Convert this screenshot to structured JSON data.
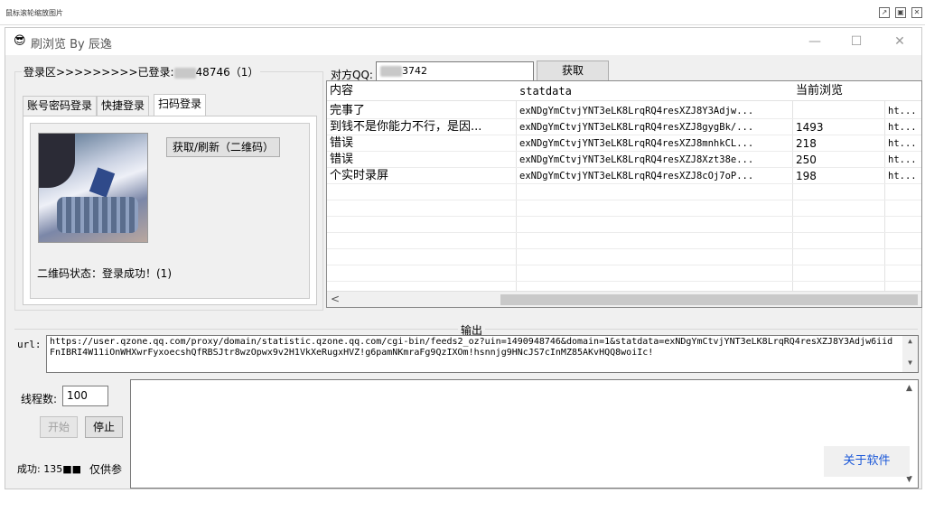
{
  "viewer": {
    "title": "鼠标滚轮缩放图片",
    "buttons": [
      "↗",
      "▣",
      "✕"
    ]
  },
  "app": {
    "title": "刷浏览 By 辰逸",
    "icon": "sunglasses-face-icon",
    "controls": {
      "minimize": "—",
      "maximize": "☐",
      "close": "✕"
    }
  },
  "login": {
    "group_title_prefix": "登录区>>>>>>>>>已登录:",
    "logged_in_suffix": "48746（1）",
    "tabs": [
      "账号密码登录",
      "快捷登录",
      "扫码登录"
    ],
    "active_tab": 2,
    "qr_button": "获取/刷新（二维码）",
    "qr_status": "二维码状态：登录成功！(1)"
  },
  "target": {
    "label": "对方QQ:",
    "value_suffix": "3742",
    "fetch_button": "获取"
  },
  "grid": {
    "columns": [
      "内容",
      "statdata",
      "当前浏览",
      ""
    ],
    "rows": [
      {
        "content": "完事了",
        "statdata": "exNDgYmCtvjYNT3eLK8LrqRQ4resXZJ8Y3Adjw...",
        "views": "",
        "link": "ht..."
      },
      {
        "content": "到钱不是你能力不行，是因...",
        "statdata": "exNDgYmCtvjYNT3eLK8LrqRQ4resXZJ8gygBk/...",
        "views": "1493",
        "link": "ht..."
      },
      {
        "content": "错误",
        "statdata": "exNDgYmCtvjYNT3eLK8LrqRQ4resXZJ8mnhkCL...",
        "views": "218",
        "link": "ht..."
      },
      {
        "content": "错误",
        "statdata": "exNDgYmCtvjYNT3eLK8LrqRQ4resXZJ8Xzt38e...",
        "views": "250",
        "link": "ht..."
      },
      {
        "content": "个实时录屏",
        "statdata": "exNDgYmCtvjYNT3eLK8LrqRQ4resXZJ8cOj7oP...",
        "views": "198",
        "link": "ht..."
      }
    ],
    "scroll_left": "<"
  },
  "output": {
    "title": "输出",
    "url_label": "url:",
    "url_value": "https://user.qzone.qq.com/proxy/domain/statistic.qzone.qq.com/cgi-bin/feeds2_oz?uin=1490948746&domain=1&statdata=exNDgYmCtvjYNT3eLK8LrqRQ4resXZJ8Y3Adjw6iidFnIBRI4W11iOnWHXwrFyxoecshQfRBSJtr8wzOpwx9v2H1VkXeRugxHVZ!g6pamNKmraFg9QzIXOm!hsnnjg9HNcJS7cInMZ85AKvHQQ8woiIc!",
    "threads_label": "线程数:",
    "threads_value": "100",
    "start_button": "开始",
    "stop_button": "停止",
    "success_label": "成功: 135■■",
    "note_label": "仅供参",
    "about_link": "关于软件"
  }
}
